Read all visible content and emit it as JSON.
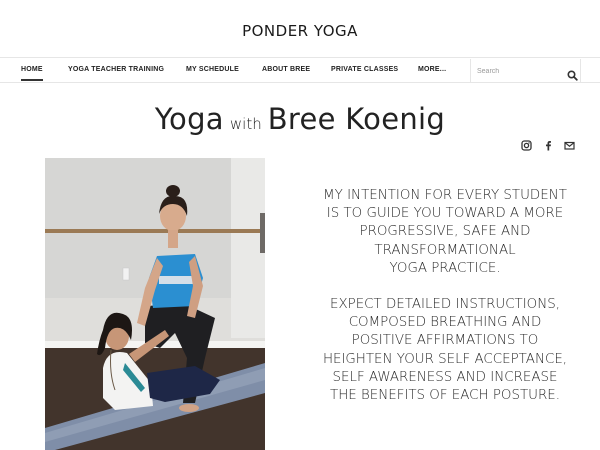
{
  "site": {
    "title": "PONDER YOGA"
  },
  "nav": {
    "items": [
      {
        "label": "HOME",
        "active": true
      },
      {
        "label": "YOGA TEACHER TRAINING",
        "active": false
      },
      {
        "label": "MY SCHEDULE",
        "active": false
      },
      {
        "label": "ABOUT BREE",
        "active": false
      },
      {
        "label": "PRIVATE CLASSES",
        "active": false
      },
      {
        "label": "MORE...",
        "active": false
      }
    ],
    "search": {
      "placeholder": "Search",
      "value": "",
      "icon": "search-icon"
    }
  },
  "heading": {
    "part1": "Yoga",
    "part2": "with",
    "part3": "Bree Koenig"
  },
  "social": [
    {
      "icon": "instagram-icon"
    },
    {
      "icon": "facebook-icon"
    },
    {
      "icon": "email-icon"
    }
  ],
  "content": {
    "paragraph1_lines": [
      "MY INTENTION FOR EVERY STUDENT",
      "IS TO GUIDE YOU TOWARD A MORE",
      "PROGRESSIVE, SAFE AND",
      "TRANSFORMATIONAL",
      "YOGA PRACTICE."
    ],
    "paragraph2_lines": [
      "EXPECT DETAILED INSTRUCTIONS,",
      "COMPOSED BREATHING AND",
      "POSITIVE AFFIRMATIONS TO",
      "HEIGHTEN YOUR SELF ACCEPTANCE,",
      "SELF AWARENESS AND INCREASE",
      "THE BENEFITS OF EACH POSTURE."
    ]
  }
}
